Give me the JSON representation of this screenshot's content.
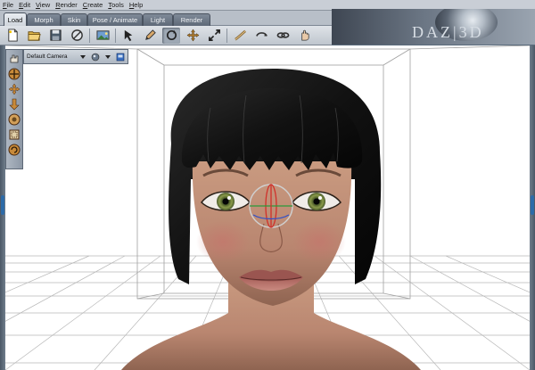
{
  "menu": [
    {
      "label": "File",
      "u": "F",
      "rest": "ile"
    },
    {
      "label": "Edit",
      "u": "E",
      "rest": "dit"
    },
    {
      "label": "View",
      "u": "V",
      "rest": "iew"
    },
    {
      "label": "Render",
      "u": "R",
      "rest": "ender"
    },
    {
      "label": "Create",
      "u": "C",
      "rest": "reate"
    },
    {
      "label": "Tools",
      "u": "T",
      "rest": "ools"
    },
    {
      "label": "Help",
      "u": "H",
      "rest": "elp"
    }
  ],
  "tabs": [
    {
      "label": "Load",
      "active": true
    },
    {
      "label": "Morph",
      "active": false
    },
    {
      "label": "Skin",
      "active": false
    },
    {
      "label": "Pose / Animate",
      "active": false
    },
    {
      "label": "Light",
      "active": false
    },
    {
      "label": "Render",
      "active": false
    }
  ],
  "brand": {
    "text": "DAZ|3D"
  },
  "toolbar": {
    "tools": [
      "new-file-icon",
      "open-folder-icon",
      "save-icon",
      "no-entry-icon",
      "image-scene-icon",
      "arrow-select-icon",
      "pencil-icon",
      "rotate-icon",
      "move-icon",
      "scale-icon",
      "bend-icon",
      "twist-icon",
      "link-icon",
      "hand-icon"
    ],
    "selected": "rotate-icon"
  },
  "camera": {
    "name": "Default Camera",
    "controls": [
      "camera-pan-icon",
      "camera-move-icon",
      "camera-tilt-icon",
      "camera-orbit-icon",
      "camera-frame-icon",
      "camera-roll-icon"
    ]
  },
  "colors": {
    "accent": "#2d6ba8",
    "chrome": "#bfc6ce",
    "viewport_bg": "#ffffff",
    "gizmo_red": "#d0302a",
    "gizmo_green": "#2a9a3a",
    "gizmo_blue": "#3050c8"
  }
}
